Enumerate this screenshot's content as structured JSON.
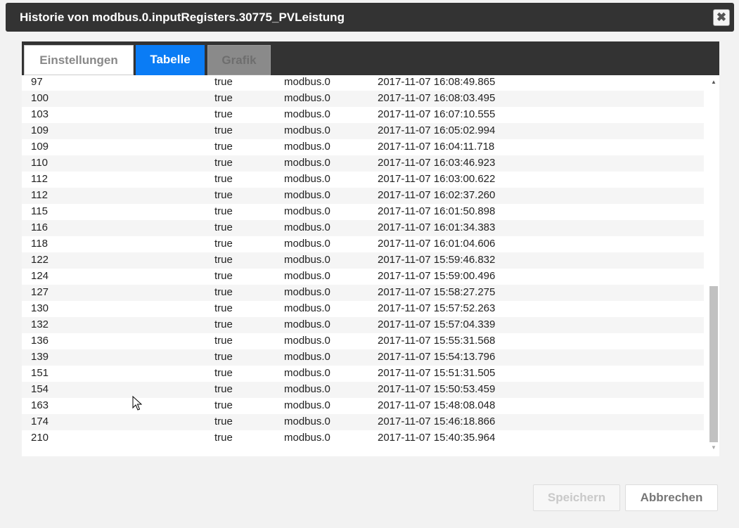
{
  "dialog": {
    "title": "Historie von modbus.0.inputRegisters.30775_PVLeistung",
    "close_label": "✖"
  },
  "tabs": [
    {
      "label": "Einstellungen"
    },
    {
      "label": "Tabelle"
    },
    {
      "label": "Grafik"
    }
  ],
  "active_tab": "Tabelle",
  "rows": [
    {
      "val": "97",
      "ack": "true",
      "from": "modbus.0",
      "ts": "2017-11-07 16:08:49.865"
    },
    {
      "val": "100",
      "ack": "true",
      "from": "modbus.0",
      "ts": "2017-11-07 16:08:03.495"
    },
    {
      "val": "103",
      "ack": "true",
      "from": "modbus.0",
      "ts": "2017-11-07 16:07:10.555"
    },
    {
      "val": "109",
      "ack": "true",
      "from": "modbus.0",
      "ts": "2017-11-07 16:05:02.994"
    },
    {
      "val": "109",
      "ack": "true",
      "from": "modbus.0",
      "ts": "2017-11-07 16:04:11.718"
    },
    {
      "val": "110",
      "ack": "true",
      "from": "modbus.0",
      "ts": "2017-11-07 16:03:46.923"
    },
    {
      "val": "112",
      "ack": "true",
      "from": "modbus.0",
      "ts": "2017-11-07 16:03:00.622"
    },
    {
      "val": "112",
      "ack": "true",
      "from": "modbus.0",
      "ts": "2017-11-07 16:02:37.260"
    },
    {
      "val": "115",
      "ack": "true",
      "from": "modbus.0",
      "ts": "2017-11-07 16:01:50.898"
    },
    {
      "val": "116",
      "ack": "true",
      "from": "modbus.0",
      "ts": "2017-11-07 16:01:34.383"
    },
    {
      "val": "118",
      "ack": "true",
      "from": "modbus.0",
      "ts": "2017-11-07 16:01:04.606"
    },
    {
      "val": "122",
      "ack": "true",
      "from": "modbus.0",
      "ts": "2017-11-07 15:59:46.832"
    },
    {
      "val": "124",
      "ack": "true",
      "from": "modbus.0",
      "ts": "2017-11-07 15:59:00.496"
    },
    {
      "val": "127",
      "ack": "true",
      "from": "modbus.0",
      "ts": "2017-11-07 15:58:27.275"
    },
    {
      "val": "130",
      "ack": "true",
      "from": "modbus.0",
      "ts": "2017-11-07 15:57:52.263"
    },
    {
      "val": "132",
      "ack": "true",
      "from": "modbus.0",
      "ts": "2017-11-07 15:57:04.339"
    },
    {
      "val": "136",
      "ack": "true",
      "from": "modbus.0",
      "ts": "2017-11-07 15:55:31.568"
    },
    {
      "val": "139",
      "ack": "true",
      "from": "modbus.0",
      "ts": "2017-11-07 15:54:13.796"
    },
    {
      "val": "151",
      "ack": "true",
      "from": "modbus.0",
      "ts": "2017-11-07 15:51:31.505"
    },
    {
      "val": "154",
      "ack": "true",
      "from": "modbus.0",
      "ts": "2017-11-07 15:50:53.459"
    },
    {
      "val": "163",
      "ack": "true",
      "from": "modbus.0",
      "ts": "2017-11-07 15:48:08.048"
    },
    {
      "val": "174",
      "ack": "true",
      "from": "modbus.0",
      "ts": "2017-11-07 15:46:18.866"
    },
    {
      "val": "210",
      "ack": "true",
      "from": "modbus.0",
      "ts": "2017-11-07 15:40:35.964"
    }
  ],
  "buttons": {
    "save_label": "Speichern",
    "cancel_label": "Abbrechen"
  },
  "icons": {
    "close": "close-icon",
    "scroll_up": "scroll-up-arrow-icon",
    "scroll_down": "scroll-down-arrow-icon",
    "cursor": "mouse-pointer-icon"
  },
  "colors": {
    "titlebar": "#333333",
    "active_tab": "#0a7cf5",
    "disabled_tab": "#8a8a8a"
  }
}
